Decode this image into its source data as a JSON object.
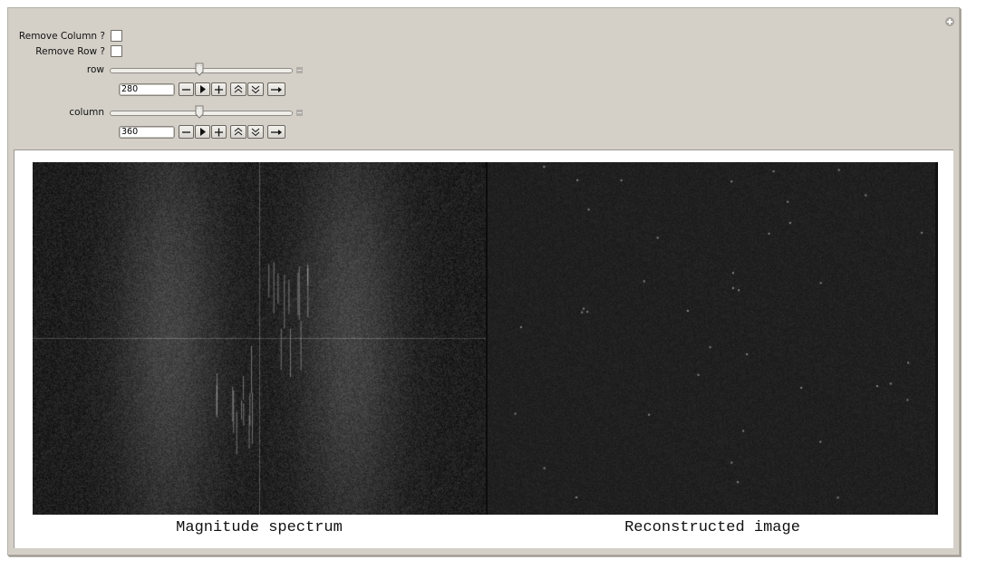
{
  "controls": {
    "remove_column": {
      "label": "Remove  Column ?",
      "checked": false
    },
    "remove_row": {
      "label": "Remove  Row ?",
      "checked": false
    },
    "row": {
      "label": "row",
      "value": "280",
      "slider_fraction": 0.49
    },
    "column": {
      "label": "column",
      "value": "360",
      "slider_fraction": 0.49
    },
    "animator_buttons": [
      {
        "name": "decrement",
        "icon": "minus-icon"
      },
      {
        "name": "play",
        "icon": "play-icon"
      },
      {
        "name": "increment",
        "icon": "plus-icon"
      },
      {
        "name": "faster",
        "icon": "double-chevron-up-icon"
      },
      {
        "name": "slower",
        "icon": "double-chevron-down-icon"
      },
      {
        "name": "direction",
        "icon": "arrow-right-icon"
      }
    ]
  },
  "output": {
    "left_caption": "Magnitude spectrum",
    "right_caption": "Reconstructed image"
  },
  "colors": {
    "panel_bg": "#d4d0c8",
    "image_bg_dark": "#1f1f1f",
    "spectrum_glow": "#5a5a5a"
  }
}
